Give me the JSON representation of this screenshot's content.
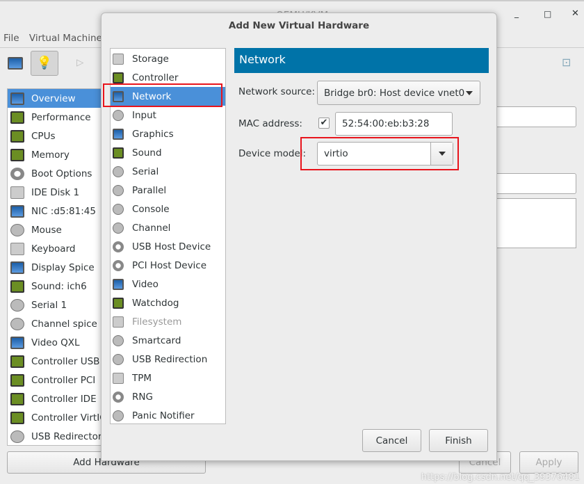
{
  "main_window": {
    "title": "... QEMU/KVM",
    "menu": [
      "File",
      "Virtual Machine"
    ],
    "hardware_list": [
      {
        "label": "Overview",
        "icon": "monitor-icon",
        "selected": true
      },
      {
        "label": "Performance",
        "icon": "performance-icon"
      },
      {
        "label": "CPUs",
        "icon": "cpu-icon"
      },
      {
        "label": "Memory",
        "icon": "memory-icon"
      },
      {
        "label": "Boot Options",
        "icon": "gear-icon"
      },
      {
        "label": "IDE Disk 1",
        "icon": "disk-icon"
      },
      {
        "label": "NIC :d5:81:45",
        "icon": "network-icon"
      },
      {
        "label": "Mouse",
        "icon": "mouse-icon"
      },
      {
        "label": "Keyboard",
        "icon": "keyboard-icon"
      },
      {
        "label": "Display Spice",
        "icon": "display-icon"
      },
      {
        "label": "Sound: ich6",
        "icon": "sound-icon"
      },
      {
        "label": "Serial 1",
        "icon": "serial-icon"
      },
      {
        "label": "Channel spice",
        "icon": "channel-icon"
      },
      {
        "label": "Video QXL",
        "icon": "video-icon"
      },
      {
        "label": "Controller USB",
        "icon": "controller-icon"
      },
      {
        "label": "Controller PCI",
        "icon": "controller-icon"
      },
      {
        "label": "Controller IDE",
        "icon": "controller-icon"
      },
      {
        "label": "Controller VirtIO",
        "icon": "controller-icon"
      },
      {
        "label": "USB Redirector",
        "icon": "usb-icon"
      }
    ],
    "add_hardware_label": "Add Hardware",
    "cancel_label": "Cancel",
    "apply_label": "Apply"
  },
  "dialog": {
    "title": "Add New Virtual Hardware",
    "items": [
      {
        "label": "Storage",
        "icon": "storage-icon"
      },
      {
        "label": "Controller",
        "icon": "controller-icon"
      },
      {
        "label": "Network",
        "icon": "network-icon",
        "selected": true
      },
      {
        "label": "Input",
        "icon": "mouse-icon"
      },
      {
        "label": "Graphics",
        "icon": "monitor-icon"
      },
      {
        "label": "Sound",
        "icon": "sound-icon"
      },
      {
        "label": "Serial",
        "icon": "serial-icon"
      },
      {
        "label": "Parallel",
        "icon": "parallel-icon"
      },
      {
        "label": "Console",
        "icon": "console-icon"
      },
      {
        "label": "Channel",
        "icon": "channel-icon"
      },
      {
        "label": "USB Host Device",
        "icon": "usb-device-icon"
      },
      {
        "label": "PCI Host Device",
        "icon": "pci-device-icon"
      },
      {
        "label": "Video",
        "icon": "video-icon"
      },
      {
        "label": "Watchdog",
        "icon": "watchdog-icon"
      },
      {
        "label": "Filesystem",
        "icon": "folder-icon",
        "disabled": true
      },
      {
        "label": "Smartcard",
        "icon": "smartcard-icon"
      },
      {
        "label": "USB Redirection",
        "icon": "usb-redirection-icon"
      },
      {
        "label": "TPM",
        "icon": "tpm-icon"
      },
      {
        "label": "RNG",
        "icon": "rng-icon"
      },
      {
        "label": "Panic Notifier",
        "icon": "panic-icon"
      }
    ],
    "section_title": "Network",
    "network_source_label": "Network source:",
    "network_source_value": "Bridge br0: Host device vnet0",
    "mac_label": "MAC address:",
    "mac_checked": true,
    "mac_value": "52:54:00:eb:b3:28",
    "device_model_label": "Device model:",
    "device_model_value": "virtio",
    "cancel_label": "Cancel",
    "finish_label": "Finish"
  },
  "watermark": "https://blog.csdn.net/qq_39376481",
  "colors": {
    "selection": "#4a90d9",
    "header": "#0073a8",
    "highlight_box": "#e8141c"
  }
}
